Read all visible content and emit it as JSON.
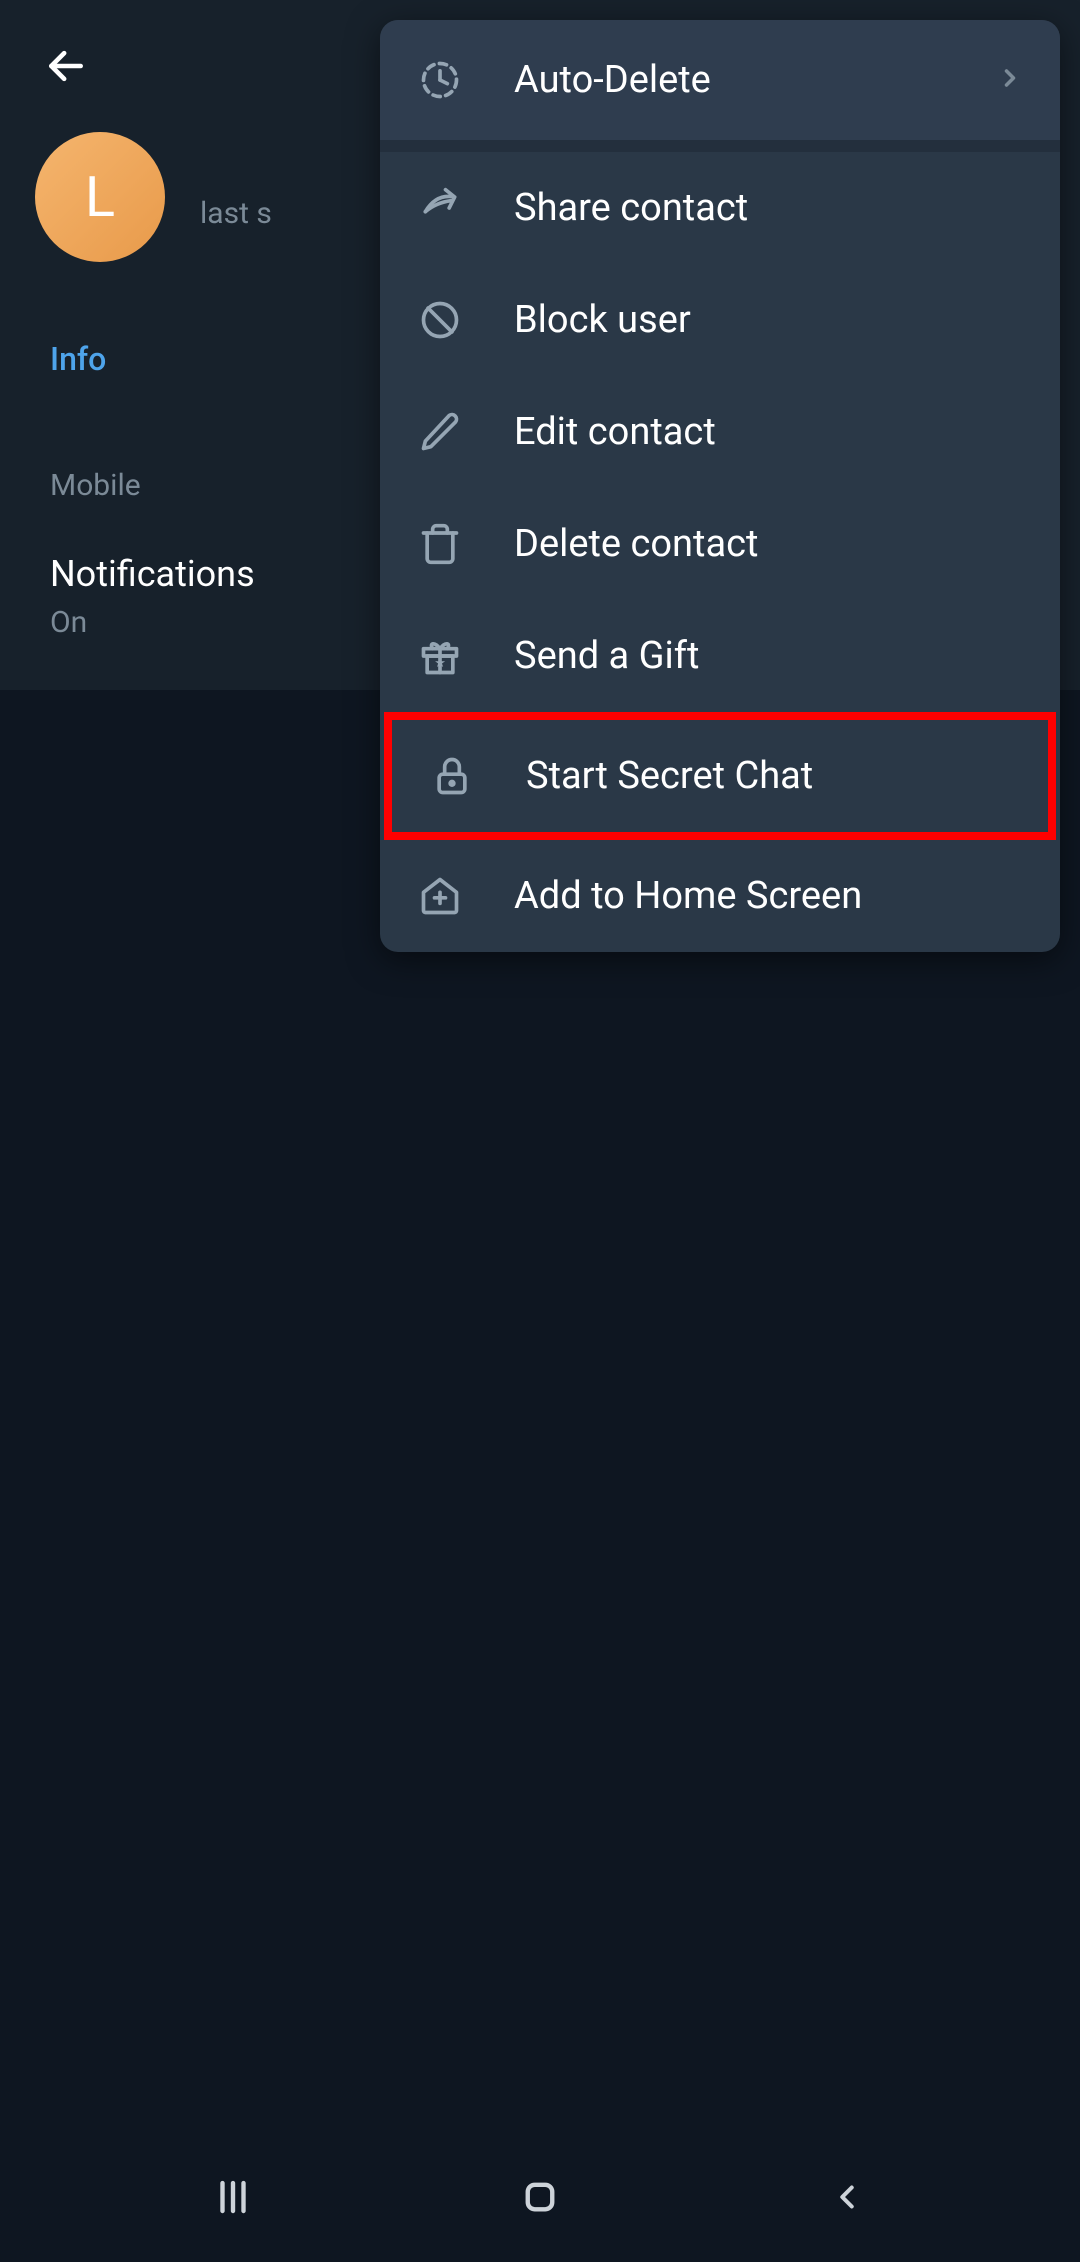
{
  "header": {
    "avatar_letter": "L",
    "status_prefix": "last s"
  },
  "info": {
    "section_label": "Info",
    "phone_label": "Mobile",
    "notifications_label": "Notifications",
    "notifications_value": "On"
  },
  "menu": {
    "auto_delete": "Auto-Delete",
    "share_contact": "Share contact",
    "block_user": "Block user",
    "edit_contact": "Edit contact",
    "delete_contact": "Delete contact",
    "send_gift": "Send a Gift",
    "start_secret_chat": "Start Secret Chat",
    "add_home_screen": "Add to Home Screen"
  }
}
